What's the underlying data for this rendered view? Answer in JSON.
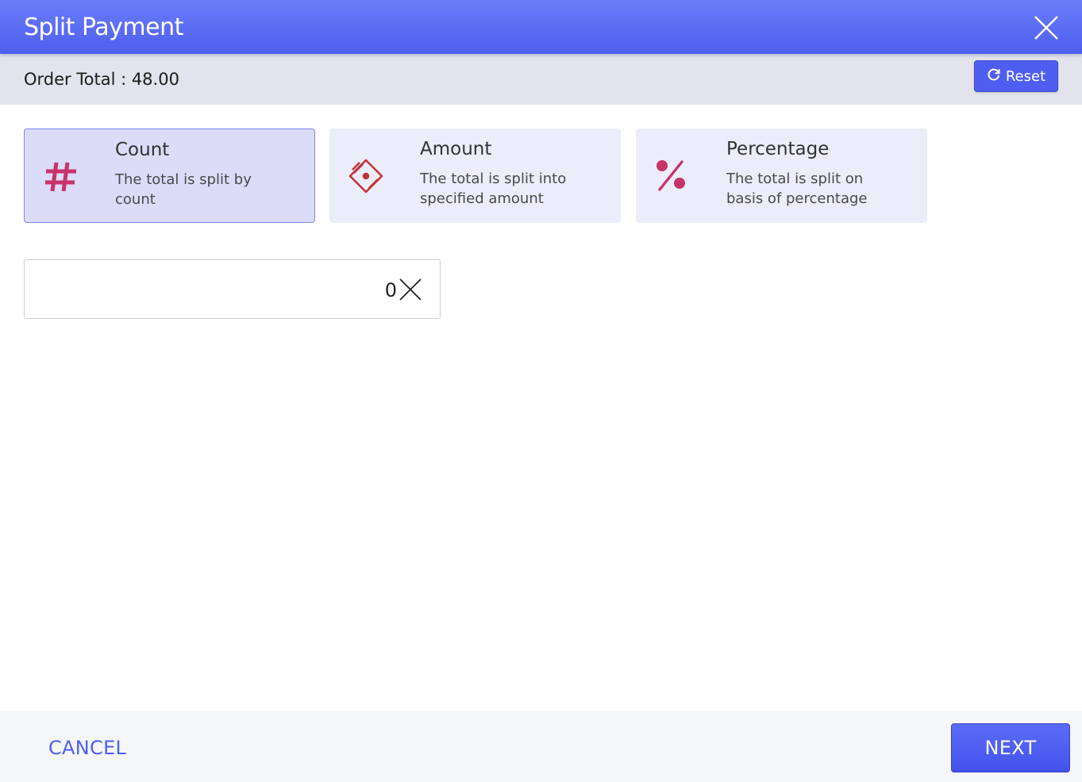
{
  "dialog": {
    "title": "Split Payment",
    "close_icon": "close-icon"
  },
  "summary": {
    "order_total": "Order Total : 48.00",
    "reset_label": "Reset",
    "reset_icon": "refresh-icon"
  },
  "options": [
    {
      "title": "Count",
      "description": "The total is split by count",
      "icon": "hash-icon",
      "selected": true
    },
    {
      "title": "Amount",
      "description": "The total is split into specified amount",
      "icon": "cash-icon",
      "selected": false
    },
    {
      "title": "Percentage",
      "description": "The total is split on basis of percentage",
      "icon": "percent-icon",
      "selected": false
    }
  ],
  "count_field": {
    "value": "0",
    "clear_icon": "clear-icon"
  },
  "footer": {
    "cancel_label": "CANCEL",
    "next_label": "NEXT"
  },
  "colors": {
    "primary": "#4f5ef0",
    "icon_accent": "#c8336a",
    "selected_card": "#dadcf8",
    "card": "#ecedfa"
  }
}
